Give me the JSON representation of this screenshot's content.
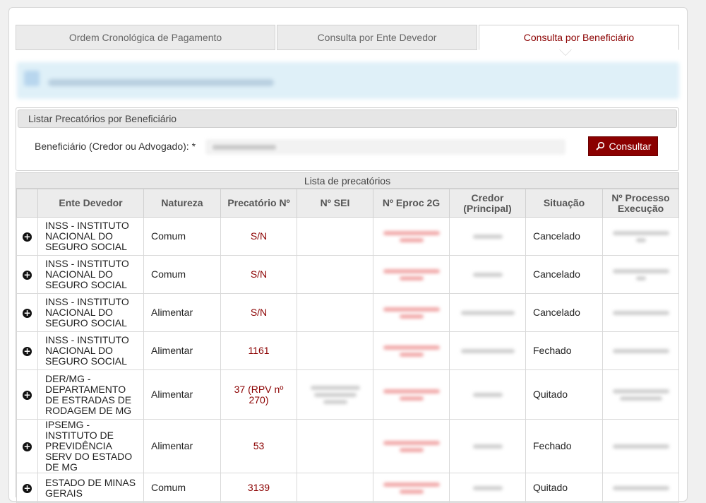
{
  "tabs": [
    {
      "label": "Ordem Cronológica de Pagamento"
    },
    {
      "label": "Consulta por Ente Devedor"
    },
    {
      "label": "Consulta por Beneficiário"
    }
  ],
  "panel": {
    "title": "Listar Precatórios por Beneficiário",
    "field_label": "Beneficiário (Credor ou Advogado): *",
    "button_label": "Consultar"
  },
  "table": {
    "caption": "Lista de precatórios",
    "headers": [
      "",
      "Ente Devedor",
      "Natureza",
      "Precatório Nº",
      "Nº SEI",
      "Nº Eproc 2G",
      "Credor (Principal)",
      "Situação",
      "Nº Processo Execução"
    ],
    "rows": [
      {
        "ente": "INSS - INSTITUTO NACIONAL DO SEGURO SOCIAL",
        "natureza": "Comum",
        "precatorio": "S/N",
        "situacao": "Cancelado"
      },
      {
        "ente": "INSS - INSTITUTO NACIONAL DO SEGURO SOCIAL",
        "natureza": "Comum",
        "precatorio": "S/N",
        "situacao": "Cancelado"
      },
      {
        "ente": "INSS - INSTITUTO NACIONAL DO SEGURO SOCIAL",
        "natureza": "Alimentar",
        "precatorio": "S/N",
        "situacao": "Cancelado"
      },
      {
        "ente": "INSS - INSTITUTO NACIONAL DO SEGURO SOCIAL",
        "natureza": "Alimentar",
        "precatorio": "1161",
        "situacao": "Fechado"
      },
      {
        "ente": "DER/MG - DEPARTAMENTO DE ESTRADAS DE RODAGEM DE MG",
        "natureza": "Alimentar",
        "precatorio": "37 (RPV nº 270)",
        "situacao": "Quitado"
      },
      {
        "ente": "IPSEMG - INSTITUTO DE PREVIDÊNCIA SERV DO ESTADO DE MG",
        "natureza": "Alimentar",
        "precatorio": "53",
        "situacao": "Fechado"
      },
      {
        "ente": "ESTADO DE MINAS GERAIS",
        "natureza": "Comum",
        "precatorio": "3139",
        "situacao": "Quitado"
      }
    ]
  },
  "colors": {
    "accent": "#8b0000",
    "header_bg": "#ececec",
    "banner_bg": "#dff0f8"
  },
  "icons": {
    "expand": "plus-circle-icon",
    "search": "magnifier-icon"
  }
}
